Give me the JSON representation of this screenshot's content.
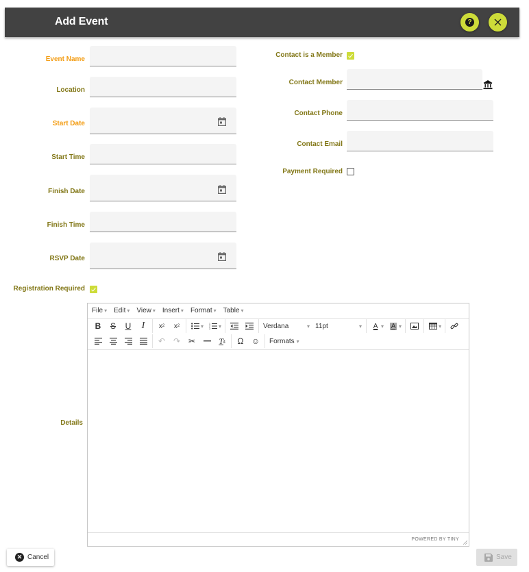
{
  "header": {
    "title": "Add Event",
    "help_icon": "help-circle-icon",
    "close_icon": "close-icon",
    "accent_color": "#cddc39",
    "bar_color": "#424242"
  },
  "left_fields": {
    "event_name": {
      "label": "Event Name",
      "value": "",
      "required": true
    },
    "location": {
      "label": "Location",
      "value": "",
      "required": false
    },
    "start_date": {
      "label": "Start Date",
      "value": "",
      "required": true,
      "icon": "calendar-icon"
    },
    "start_time": {
      "label": "Start Time",
      "value": "",
      "required": false
    },
    "finish_date": {
      "label": "Finish Date",
      "value": "",
      "required": false,
      "icon": "calendar-icon"
    },
    "finish_time": {
      "label": "Finish Time",
      "value": "",
      "required": false
    },
    "rsvp_date": {
      "label": "RSVP Date",
      "value": "",
      "required": false,
      "icon": "calendar-icon"
    },
    "registration_required": {
      "label": "Registration Required",
      "checked": true
    }
  },
  "right_fields": {
    "contact_is_member": {
      "label": "Contact is a Member",
      "checked": true
    },
    "contact_member": {
      "label": "Contact Member",
      "value": "",
      "icon": "bank-icon"
    },
    "contact_phone": {
      "label": "Contact Phone",
      "value": ""
    },
    "contact_email": {
      "label": "Contact Email",
      "value": ""
    },
    "payment_required": {
      "label": "Payment Required",
      "checked": false
    }
  },
  "details": {
    "label": "Details",
    "editor": {
      "menus": [
        "File",
        "Edit",
        "View",
        "Insert",
        "Format",
        "Table"
      ],
      "font_family": "Verdana",
      "font_size": "11pt",
      "formats_label": "Formats",
      "powered_by": "POWERED BY TINY",
      "content": ""
    }
  },
  "footer": {
    "cancel_label": "Cancel",
    "save_label": "Save",
    "save_enabled": false
  },
  "colors": {
    "label": "#827717",
    "required_label": "#f39c12",
    "input_bg": "#f4f4f4"
  }
}
